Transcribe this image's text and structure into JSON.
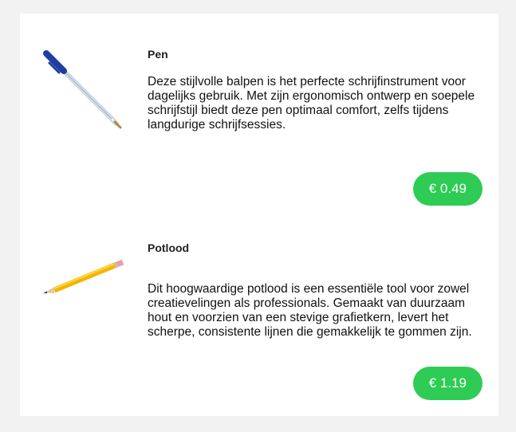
{
  "products": [
    {
      "name": "Pen",
      "description": "Deze stijlvolle balpen is het perfecte schrijfinstrument voor dagelijks gebruik. Met zijn ergonomisch ontwerp en soepele schrijfstijl biedt deze pen optimaal comfort, zelfs tijdens langdurige schrijfsessies.",
      "price": "€ 0.49",
      "image_icon": "ballpoint-pen-icon",
      "accent_color": "#2ecc55"
    },
    {
      "name": "Potlood",
      "description": "Dit hoogwaardige potlood is een essentiële tool voor zowel creatievelingen als professionals. Gemaakt van duurzaam hout en voorzien van een stevige grafietkern, levert het scherpe, consistente lijnen die gemakkelijk te gommen zijn.",
      "price": "€ 1.19",
      "image_icon": "pencil-icon",
      "accent_color": "#2ecc55"
    }
  ]
}
